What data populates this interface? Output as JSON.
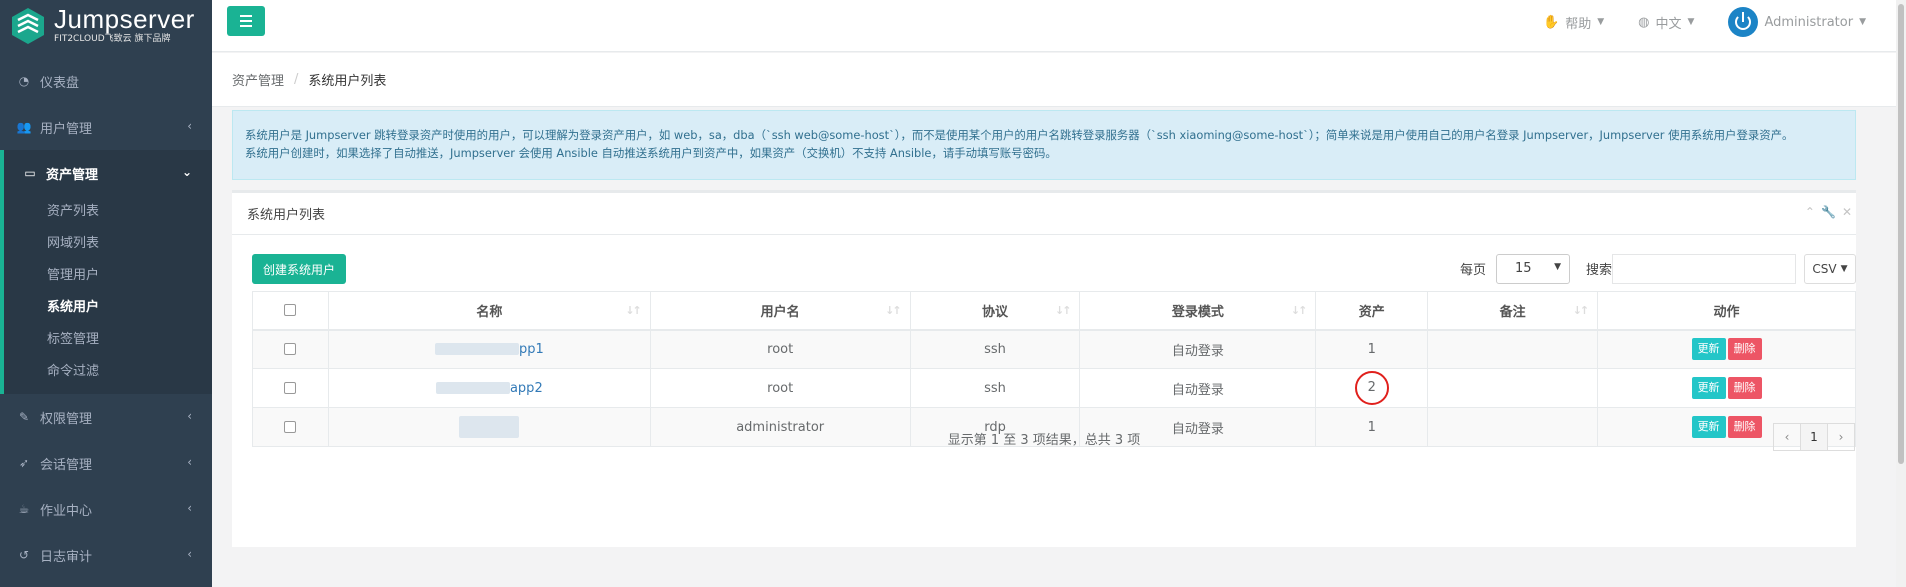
{
  "brand": {
    "name": "Jumpserver",
    "tagline": "FIT2CLOUD飞致云 旗下品牌"
  },
  "sidebar": {
    "items": [
      {
        "label": "仪表盘",
        "icon": "dashboard-icon"
      },
      {
        "label": "用户管理",
        "icon": "users-icon"
      },
      {
        "label": "资产管理",
        "icon": "inbox-icon",
        "active": true
      },
      {
        "label": "权限管理",
        "icon": "edit-icon"
      },
      {
        "label": "会话管理",
        "icon": "rocket-icon"
      },
      {
        "label": "作业中心",
        "icon": "coffee-icon"
      },
      {
        "label": "日志审计",
        "icon": "history-icon"
      }
    ],
    "subitems": [
      "资产列表",
      "网域列表",
      "管理用户",
      "系统用户",
      "标签管理",
      "命令过滤"
    ]
  },
  "topbar": {
    "help": "帮助",
    "lang": "中文",
    "user": "Administrator"
  },
  "breadcrumb": {
    "parent": "资产管理",
    "current": "系统用户列表"
  },
  "info": {
    "line1": "系统用户是 Jumpserver 跳转登录资产时使用的用户，可以理解为登录资产用户，如 web，sa，dba（`ssh web@some-host`），而不是使用某个用户的用户名跳转登录服务器（`ssh xiaoming@some-host`）；简单来说是用户使用自己的用户名登录 Jumpserver，Jumpserver 使用系统用户登录资产。",
    "line2": "系统用户创建时，如果选择了自动推送，Jumpserver 会使用 Ansible 自动推送系统用户到资产中，如果资产（交换机）不支持 Ansible，请手动填写账号密码。"
  },
  "panel": {
    "title": "系统用户列表",
    "create_label": "创建系统用户",
    "page_size_label": "每页",
    "page_size": "15",
    "search_label": "搜索",
    "search_value": "",
    "csv_label": "CSV"
  },
  "table": {
    "headers": [
      "名称",
      "用户名",
      "协议",
      "登录模式",
      "资产",
      "备注",
      "动作"
    ],
    "rows": [
      {
        "name": "pp1",
        "username": "root",
        "protocol": "ssh",
        "mode": "自动登录",
        "assets": "1",
        "note": ""
      },
      {
        "name": "app2",
        "username": "root",
        "protocol": "ssh",
        "mode": "自动登录",
        "assets": "2",
        "note": ""
      },
      {
        "name": "",
        "username": "administrator",
        "protocol": "rdp",
        "mode": "自动登录",
        "assets": "1",
        "note": ""
      }
    ],
    "update_label": "更新",
    "delete_label": "删除"
  },
  "footer": {
    "summary": "显示第 1 至 3 项结果，总共 3 项",
    "page": "1",
    "prev": "‹",
    "next": "›"
  },
  "colors": {
    "sidebar": "#2f4050",
    "primary": "#1ab394",
    "info": "#23c6c8",
    "danger": "#ed5565",
    "highlight": "#e0201c"
  }
}
